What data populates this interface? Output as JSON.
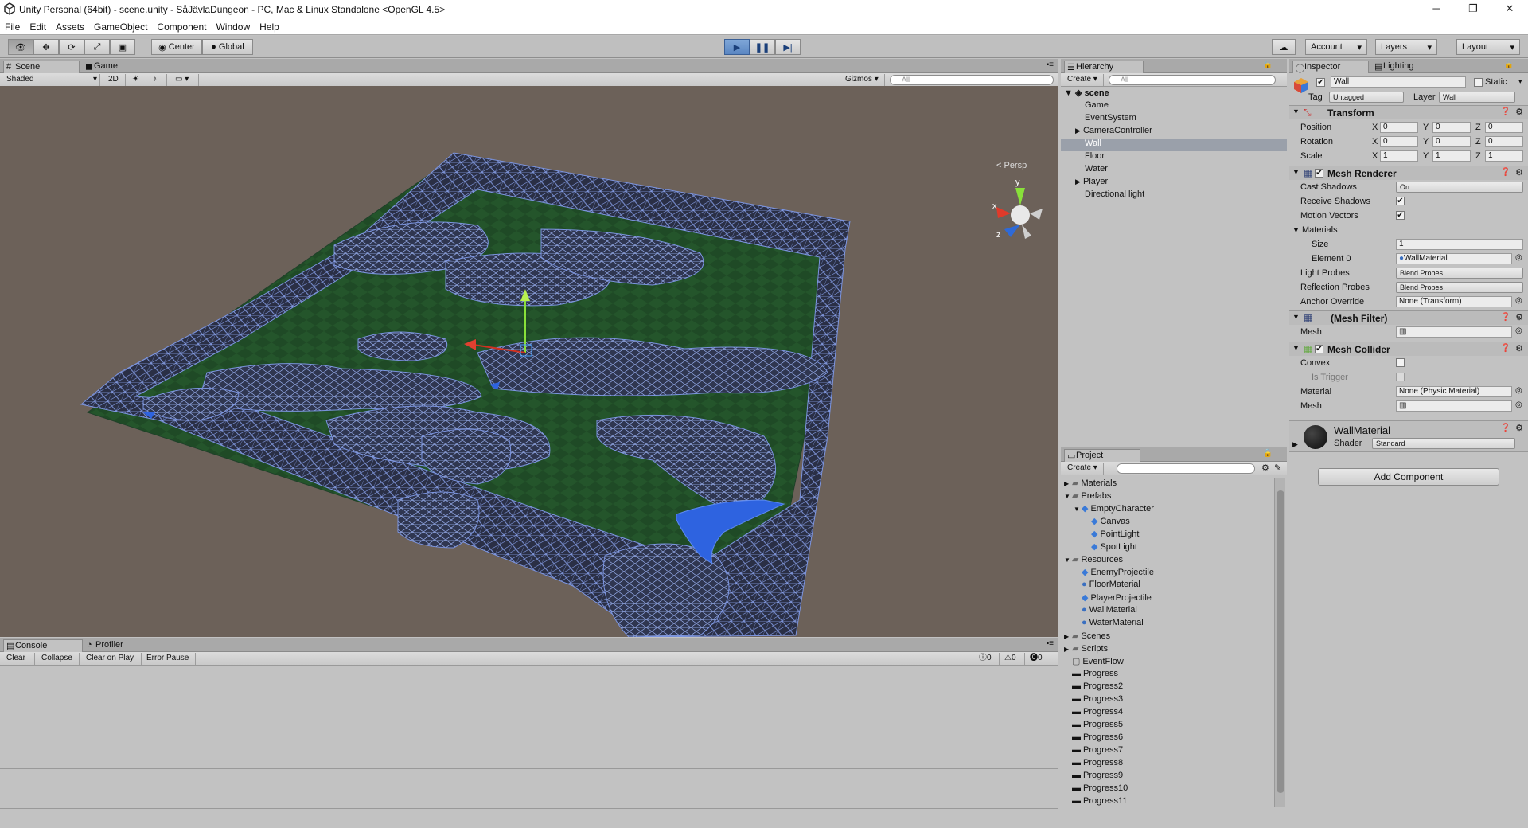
{
  "window": {
    "title": "Unity Personal (64bit) - scene.unity - SåJävlaDungeon - PC, Mac & Linux Standalone <OpenGL 4.5>",
    "minimize": "─",
    "maximize": "❐",
    "close": "✕"
  },
  "menu": [
    "File",
    "Edit",
    "Assets",
    "GameObject",
    "Component",
    "Window",
    "Help"
  ],
  "toolbar": {
    "center": "Center",
    "global": "Global",
    "account": "Account",
    "layers": "Layers",
    "layout": "Layout"
  },
  "scene_view": {
    "tab_scene": "Scene",
    "tab_game": "Game",
    "shading": "Shaded",
    "mode_2d": "2D",
    "gizmos": "Gizmos",
    "search_placeholder": "All",
    "persp": "< Persp",
    "axis_y": "y",
    "axis_x": "x",
    "axis_z": "z"
  },
  "hierarchy": {
    "tab": "Hierarchy",
    "create": "Create",
    "search": "All",
    "scene": "scene",
    "items": [
      "Game",
      "EventSystem",
      "CameraController",
      "Wall",
      "Floor",
      "Water",
      "Player",
      "Directional light"
    ],
    "selected": "Wall"
  },
  "inspector": {
    "tab": "Inspector",
    "tab2": "Lighting",
    "name": "Wall",
    "static": "Static",
    "tag_label": "Tag",
    "tag": "Untagged",
    "layer_label": "Layer",
    "layer": "Wall",
    "transform": {
      "title": "Transform",
      "position": "Position",
      "rotation": "Rotation",
      "scale": "Scale",
      "pos": [
        "0",
        "0",
        "0"
      ],
      "rot": [
        "0",
        "0",
        "0"
      ],
      "scl": [
        "1",
        "1",
        "1"
      ],
      "x": "X",
      "y": "Y",
      "z": "Z"
    },
    "mesh_renderer": {
      "title": "Mesh Renderer",
      "cast_shadows": "Cast Shadows",
      "cast_value": "On",
      "receive_shadows": "Receive Shadows",
      "motion_vectors": "Motion Vectors",
      "materials": "Materials",
      "size": "Size",
      "size_value": "1",
      "element0": "Element 0",
      "element0_value": "WallMaterial",
      "light_probes": "Light Probes",
      "light_value": "Blend Probes",
      "reflection_probes": "Reflection Probes",
      "reflection_value": "Blend Probes",
      "anchor_override": "Anchor Override",
      "anchor_value": "None (Transform)"
    },
    "mesh_filter": {
      "title": "(Mesh Filter)",
      "mesh": "Mesh"
    },
    "mesh_collider": {
      "title": "Mesh Collider",
      "convex": "Convex",
      "is_trigger": "Is Trigger",
      "material": "Material",
      "material_value": "None (Physic Material)",
      "mesh": "Mesh"
    },
    "material": {
      "name": "WallMaterial",
      "shader_label": "Shader",
      "shader": "Standard"
    },
    "add_component": "Add Component"
  },
  "project": {
    "tab": "Project",
    "create": "Create",
    "items": [
      {
        "label": "Materials",
        "indent": 0,
        "type": "folder",
        "arrow": "▶"
      },
      {
        "label": "Prefabs",
        "indent": 0,
        "type": "folder",
        "arrow": "▼"
      },
      {
        "label": "EmptyCharacter",
        "indent": 1,
        "type": "prefab",
        "arrow": "▼"
      },
      {
        "label": "Canvas",
        "indent": 2,
        "type": "prefab",
        "arrow": ""
      },
      {
        "label": "PointLight",
        "indent": 2,
        "type": "prefab",
        "arrow": ""
      },
      {
        "label": "SpotLight",
        "indent": 2,
        "type": "prefab",
        "arrow": ""
      },
      {
        "label": "Resources",
        "indent": 0,
        "type": "folder",
        "arrow": "▼"
      },
      {
        "label": "EnemyProjectile",
        "indent": 1,
        "type": "prefab",
        "arrow": ""
      },
      {
        "label": "FloorMaterial",
        "indent": 1,
        "type": "material",
        "arrow": ""
      },
      {
        "label": "PlayerProjectile",
        "indent": 1,
        "type": "prefab",
        "arrow": ""
      },
      {
        "label": "WallMaterial",
        "indent": 1,
        "type": "material",
        "arrow": ""
      },
      {
        "label": "WaterMaterial",
        "indent": 1,
        "type": "material",
        "arrow": ""
      },
      {
        "label": "Scenes",
        "indent": 0,
        "type": "folder",
        "arrow": "▶"
      },
      {
        "label": "Scripts",
        "indent": 0,
        "type": "folder",
        "arrow": "▶"
      },
      {
        "label": "EventFlow",
        "indent": 0,
        "type": "file",
        "arrow": ""
      },
      {
        "label": "Progress",
        "indent": 0,
        "type": "texture",
        "arrow": ""
      },
      {
        "label": "Progress2",
        "indent": 0,
        "type": "texture",
        "arrow": ""
      },
      {
        "label": "Progress3",
        "indent": 0,
        "type": "texture",
        "arrow": ""
      },
      {
        "label": "Progress4",
        "indent": 0,
        "type": "texture",
        "arrow": ""
      },
      {
        "label": "Progress5",
        "indent": 0,
        "type": "texture",
        "arrow": ""
      },
      {
        "label": "Progress6",
        "indent": 0,
        "type": "texture",
        "arrow": ""
      },
      {
        "label": "Progress7",
        "indent": 0,
        "type": "texture",
        "arrow": ""
      },
      {
        "label": "Progress8",
        "indent": 0,
        "type": "texture",
        "arrow": ""
      },
      {
        "label": "Progress9",
        "indent": 0,
        "type": "texture",
        "arrow": ""
      },
      {
        "label": "Progress10",
        "indent": 0,
        "type": "texture",
        "arrow": ""
      },
      {
        "label": "Progress11",
        "indent": 0,
        "type": "texture",
        "arrow": ""
      }
    ]
  },
  "console": {
    "tab": "Console",
    "tab2": "Profiler",
    "clear": "Clear",
    "collapse": "Collapse",
    "clear_on_play": "Clear on Play",
    "error_pause": "Error Pause",
    "log_count": "0",
    "warn_count": "0",
    "err_count": "0"
  }
}
